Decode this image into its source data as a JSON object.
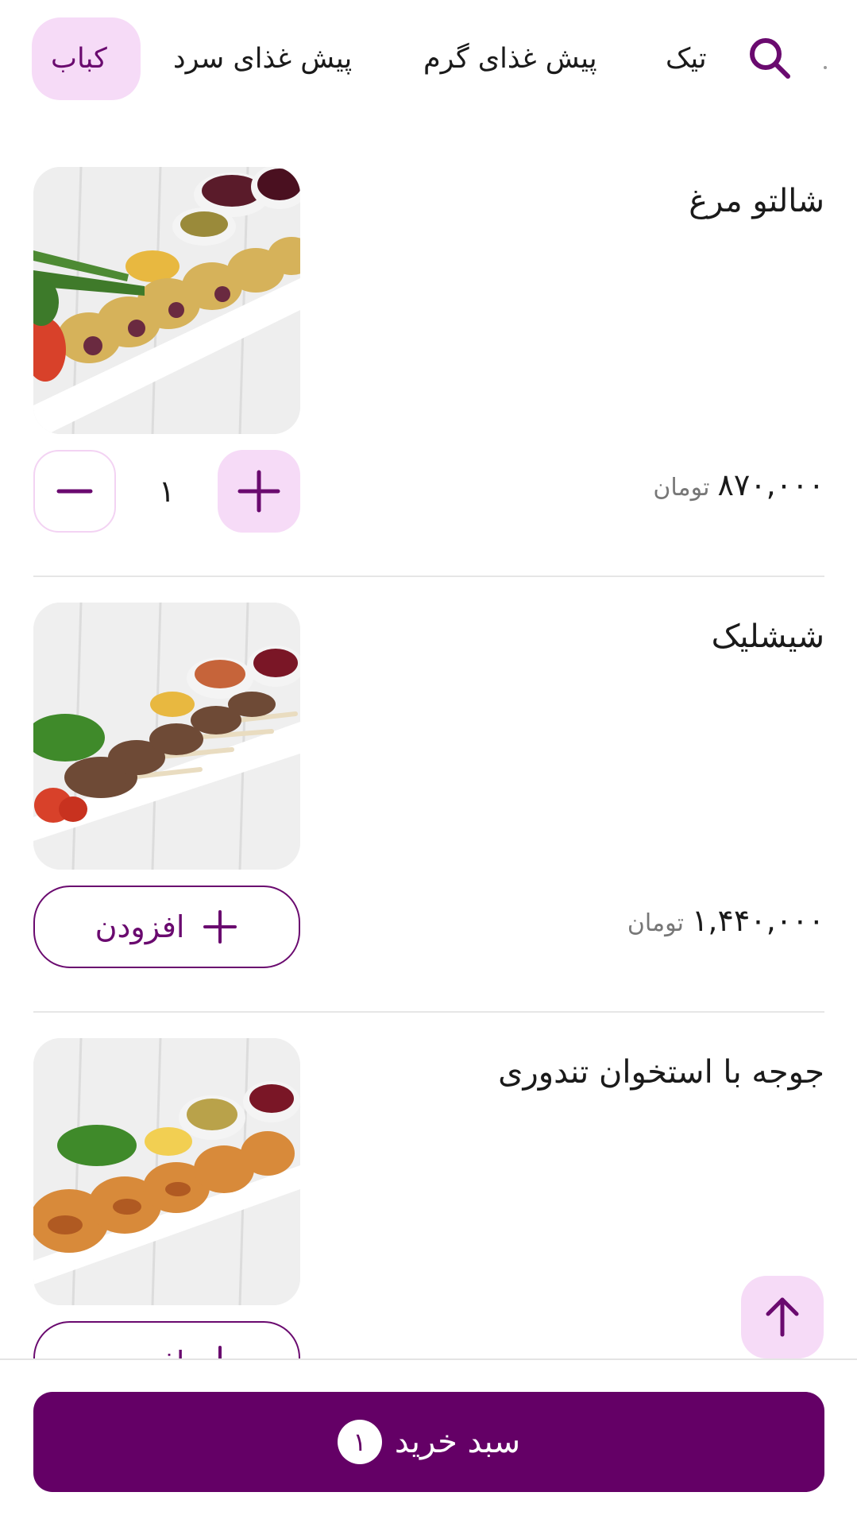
{
  "categories": {
    "items": [
      {
        "label": "کباب",
        "active": true
      },
      {
        "label": "پیش غذای سرد",
        "active": false
      },
      {
        "label": "پیش غذای گرم",
        "active": false
      },
      {
        "label": "تیک",
        "active": false
      }
    ]
  },
  "products": [
    {
      "title": "شالتو مرغ",
      "price": "۸۷۰,۰۰۰",
      "currency": "تومان",
      "quantity": "۱",
      "in_cart": true
    },
    {
      "title": "شیشلیک",
      "price": "۱,۴۴۰,۰۰۰",
      "currency": "تومان",
      "add_label": "افزودن",
      "in_cart": false
    },
    {
      "title": "جوجه با استخوان تندوری",
      "add_label": "افزودن",
      "in_cart": false
    }
  ],
  "cart": {
    "label": "سبد خرید",
    "count": "۱"
  },
  "colors": {
    "brand": "#640066",
    "accent": "#6a0a6f",
    "accent_light": "#f6dbf7"
  },
  "icons": [
    "search-icon",
    "minus-icon",
    "plus-icon",
    "arrow-up-icon"
  ]
}
